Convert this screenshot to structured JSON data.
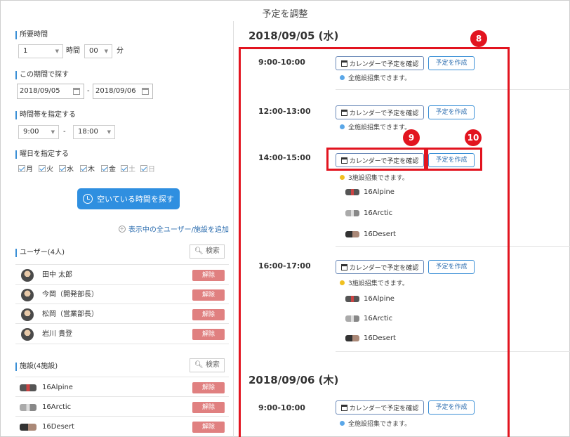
{
  "page": {
    "title": "予定を調整"
  },
  "left": {
    "duration": {
      "label": "所要時間",
      "hours_value": "1",
      "hours_unit": "時間",
      "minutes_value": "00",
      "minutes_unit": "分"
    },
    "period": {
      "label": "この期間で探す",
      "from": "2018/09/05",
      "separator": "-",
      "to": "2018/09/06"
    },
    "timeband": {
      "label": "時間帯を指定する",
      "from": "9:00",
      "separator": "-",
      "to": "18:00"
    },
    "weekday": {
      "label": "曜日を指定する",
      "days": [
        {
          "name": "月",
          "checked": true
        },
        {
          "name": "火",
          "checked": true
        },
        {
          "name": "水",
          "checked": true
        },
        {
          "name": "木",
          "checked": true
        },
        {
          "name": "金",
          "checked": true
        },
        {
          "name": "土",
          "checked": false
        },
        {
          "name": "日",
          "checked": false
        }
      ]
    },
    "find_button": "空いている時間を探す",
    "add_all_link": "表示中の全ユーザー/施設を追加",
    "users": {
      "header": "ユーザー(4人)",
      "search": "検索",
      "items": [
        {
          "name": "田中 太郎",
          "action": "解除"
        },
        {
          "name": "今岡（開発部長）",
          "action": "解除"
        },
        {
          "name": "松岡（営業部長）",
          "action": "解除"
        },
        {
          "name": "岩川 貴登",
          "action": "解除"
        }
      ]
    },
    "facilities": {
      "header": "施設(4施設)",
      "search": "検索",
      "items": [
        {
          "name": "16Alpine",
          "action": "解除"
        },
        {
          "name": "16Arctic",
          "action": "解除"
        },
        {
          "name": "16Desert",
          "action": "解除"
        }
      ]
    }
  },
  "right": {
    "days": [
      {
        "date": "2018/09/05 (水)",
        "slots": [
          {
            "time": "9:00-10:00",
            "check_calendar": "カレンダーで予定を確認",
            "create": "予定を作成",
            "availability": "全施設招集できます。",
            "dot_color": "#5aa7e8",
            "facilities": []
          },
          {
            "time": "12:00-13:00",
            "check_calendar": "カレンダーで予定を確認",
            "create": "予定を作成",
            "availability": "全施設招集できます。",
            "dot_color": "#5aa7e8",
            "facilities": []
          },
          {
            "time": "14:00-15:00",
            "check_calendar": "カレンダーで予定を確認",
            "create": "予定を作成",
            "availability": "3施設招集できます。",
            "dot_color": "#f0c020",
            "facilities": [
              "16Alpine",
              "16Arctic",
              "16Desert"
            ]
          },
          {
            "time": "16:00-17:00",
            "check_calendar": "カレンダーで予定を確認",
            "create": "予定を作成",
            "availability": "3施設招集できます。",
            "dot_color": "#f0c020",
            "facilities": [
              "16Alpine",
              "16Arctic",
              "16Desert"
            ]
          }
        ]
      },
      {
        "date": "2018/09/06 (木)",
        "slots": [
          {
            "time": "9:00-10:00",
            "check_calendar": "カレンダーで予定を確認",
            "create": "予定を作成",
            "availability": "全施設招集できます。",
            "dot_color": "#5aa7e8",
            "facilities": []
          }
        ]
      }
    ]
  },
  "callouts": {
    "c8": "8",
    "c9": "9",
    "c10": "10",
    "color": "#e2141f"
  }
}
